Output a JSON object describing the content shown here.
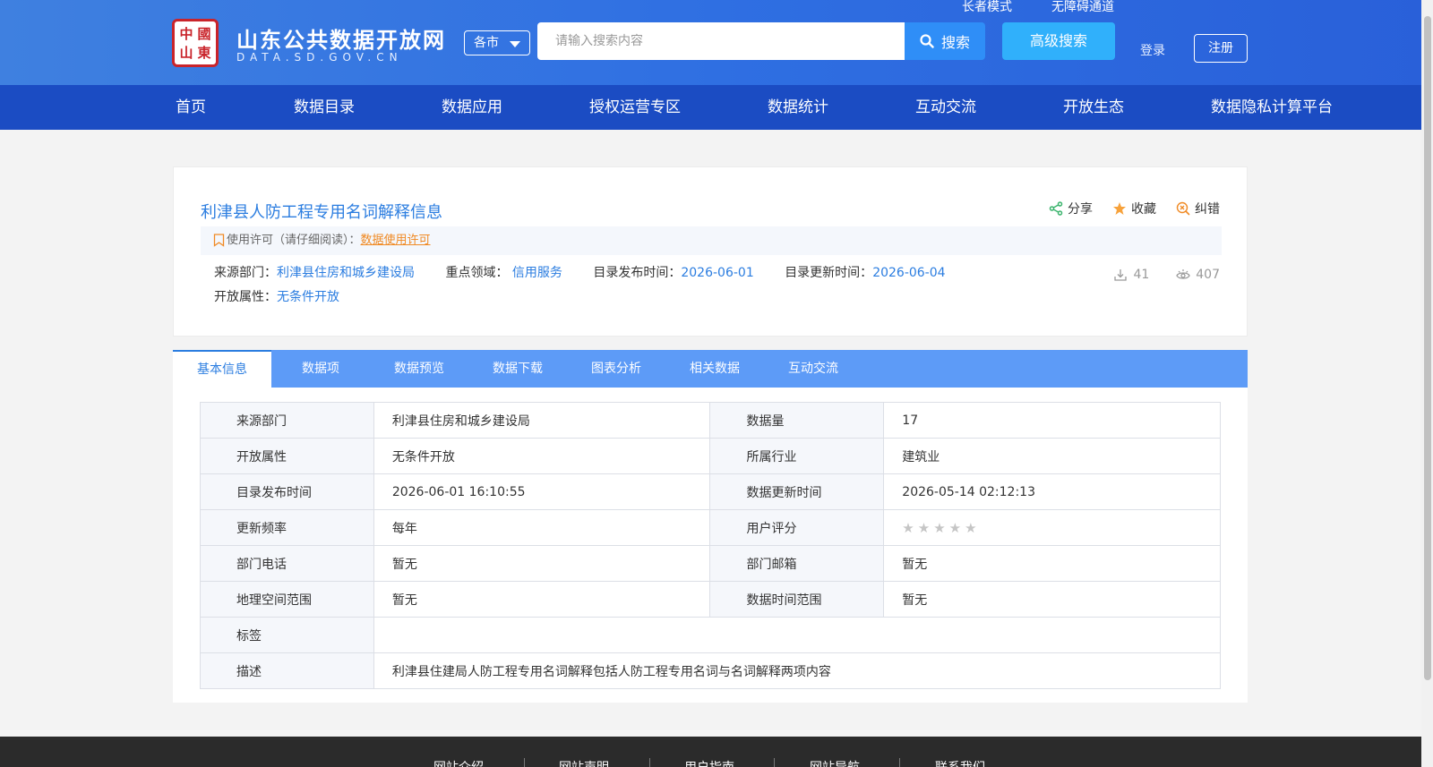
{
  "header": {
    "logo_seal_chars": [
      "中",
      "國",
      "山",
      "東"
    ],
    "site_title": "山东公共数据开放网",
    "site_subtitle": "DATA.SD.GOV.CN",
    "city_select": "各市",
    "search_placeholder": "请输入搜索内容",
    "search_button": "搜索",
    "advanced_search": "高级搜索",
    "elder_mode": "长者模式",
    "accessibility": "无障碍通道",
    "login": "登录",
    "register": "注册"
  },
  "nav": {
    "items": [
      "首页",
      "数据目录",
      "数据应用",
      "授权运营专区",
      "数据统计",
      "互动交流",
      "开放生态",
      "数据隐私计算平台"
    ]
  },
  "dataset": {
    "title": "利津县人防工程专用名词解释信息",
    "share": "分享",
    "favorite": "收藏",
    "report_error": "纠错",
    "license_label": "使用许可（请仔细阅读）：",
    "license_link": "数据使用许可",
    "source_dept_label": "来源部门：",
    "source_dept": "利津县住房和城乡建设局",
    "domain_label": "重点领域：",
    "domain": "信用服务",
    "publish_label": "目录发布时间：",
    "publish_date": "2026-06-01",
    "update_label": "目录更新时间：",
    "update_date": "2026-06-04",
    "open_attr_label": "开放属性：",
    "open_attr": "无条件开放",
    "downloads": "41",
    "views": "407"
  },
  "tabs": [
    "基本信息",
    "数据项",
    "数据预览",
    "数据下载",
    "图表分析",
    "相关数据",
    "互动交流"
  ],
  "info_table": {
    "rows": [
      {
        "l1": "来源部门",
        "v1": "利津县住房和城乡建设局",
        "l2": "数据量",
        "v2": "17"
      },
      {
        "l1": "开放属性",
        "v1": "无条件开放",
        "l2": "所属行业",
        "v2": "建筑业"
      },
      {
        "l1": "目录发布时间",
        "v1": "2026-06-01 16:10:55",
        "l2": "数据更新时间",
        "v2": "2026-05-14 02:12:13"
      },
      {
        "l1": "更新频率",
        "v1": "每年",
        "l2": "用户评分",
        "v2": ""
      },
      {
        "l1": "部门电话",
        "v1": "暂无",
        "l2": "部门邮箱",
        "v2": "暂无"
      },
      {
        "l1": "地理空间范围",
        "v1": "暂无",
        "l2": "数据时间范围",
        "v2": "暂无"
      }
    ],
    "rating_stars": 0,
    "rating_max": 5,
    "tag_label": "标签",
    "tag_value": "",
    "desc_label": "描述",
    "desc_value": "利津县住建局人防工程专用名词解释包括人防工程专用名词与名词解释两项内容"
  },
  "footer": {
    "links": [
      "网站介绍",
      "网站声明",
      "用户指南",
      "网站导航",
      "联系我们"
    ]
  },
  "colors": {
    "header_blue": "#2f6fe2",
    "nav_blue": "#1b4cc3",
    "tab_blue": "#5d9bf7",
    "link_blue": "#2b7de0",
    "license_orange": "#f08a24"
  }
}
